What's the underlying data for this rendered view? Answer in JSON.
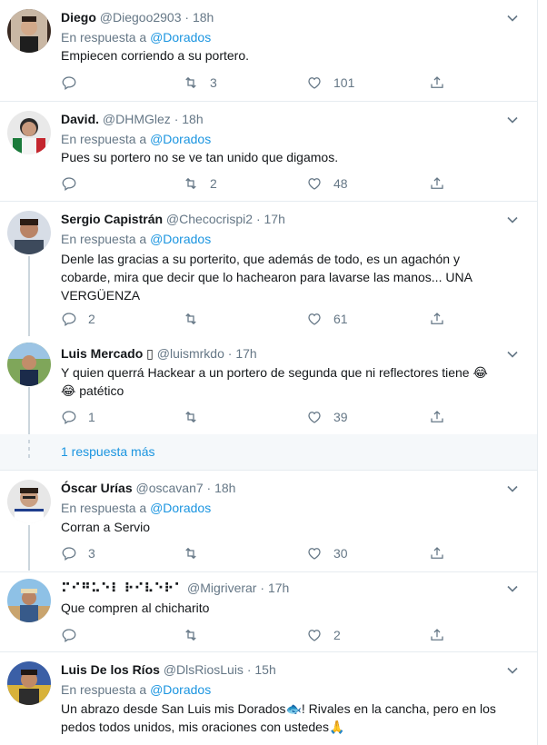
{
  "tweets": [
    {
      "name": "Diego",
      "handle": "@Diegoo2903",
      "time": "18h",
      "reply_prefix": "En respuesta a",
      "reply_mention": "@Dorados",
      "text": "Empiecen corriendo a su portero.",
      "replies": "",
      "retweets": "3",
      "likes": "101"
    },
    {
      "name": "David.",
      "handle": "@DHMGlez",
      "time": "18h",
      "reply_prefix": "En respuesta a",
      "reply_mention": "@Dorados",
      "text": "Pues su portero no se ve tan unido que digamos.",
      "replies": "",
      "retweets": "2",
      "likes": "48"
    },
    {
      "name": "Sergio Capistrán",
      "handle": "@Checocrispi2",
      "time": "17h",
      "reply_prefix": "En respuesta a",
      "reply_mention": "@Dorados",
      "text_line1": "Denle las gracias a su porterito, que además de todo, es un agachón y",
      "text_line2": "cobarde, mira que decir que lo hachearon para lavarse las manos... UNA",
      "text_line3": "VERGÜENZA",
      "replies": "2",
      "retweets": "",
      "likes": "61"
    },
    {
      "name": "Luis Mercado",
      "name_suffix": "▯",
      "handle": "@luismrkdo",
      "time": "17h",
      "text_line1": "Y quien querrá Hackear a un portero de segunda que ni reflectores tiene",
      "text_line2": "patético",
      "emoji": "😂",
      "replies": "1",
      "retweets": "",
      "likes": "39"
    },
    {
      "name": "Óscar Urías",
      "handle": "@oscavan7",
      "time": "18h",
      "reply_prefix": "En respuesta a",
      "reply_mention": "@Dorados",
      "text": "Corran a Servio",
      "replies": "3",
      "retweets": "",
      "likes": "30"
    },
    {
      "name": "⠍⠊⠛⠥⠑⠇ ⠗⠊⠧⠑⠗⠁",
      "handle": "@Migriverar",
      "time": "17h",
      "text": "Que compren al chicharito",
      "replies": "",
      "retweets": "",
      "likes": "2"
    },
    {
      "name": "Luis De los Ríos",
      "handle": "@DlsRiosLuis",
      "time": "15h",
      "reply_prefix": "En respuesta a",
      "reply_mention": "@Dorados",
      "text_line1a": "Un abrazo desde San Luis mis Dorados",
      "text_line1b": "! Rivales en la cancha, pero en los",
      "text_line2": "pedos todos unidos, mis oraciones con ustedes",
      "emoji_fish": "🐟",
      "emoji_pray": "🙏"
    }
  ],
  "more_replies_label": "1 respuesta más",
  "colors": {
    "accent": "#1b95e0",
    "muted": "#657786",
    "border": "#e6ecf0",
    "thread_line": "#ccd6dd",
    "more_bg": "#f5f8fa"
  },
  "icons": [
    "reply-icon",
    "retweet-icon",
    "like-icon",
    "share-icon",
    "chevron-down-icon"
  ]
}
